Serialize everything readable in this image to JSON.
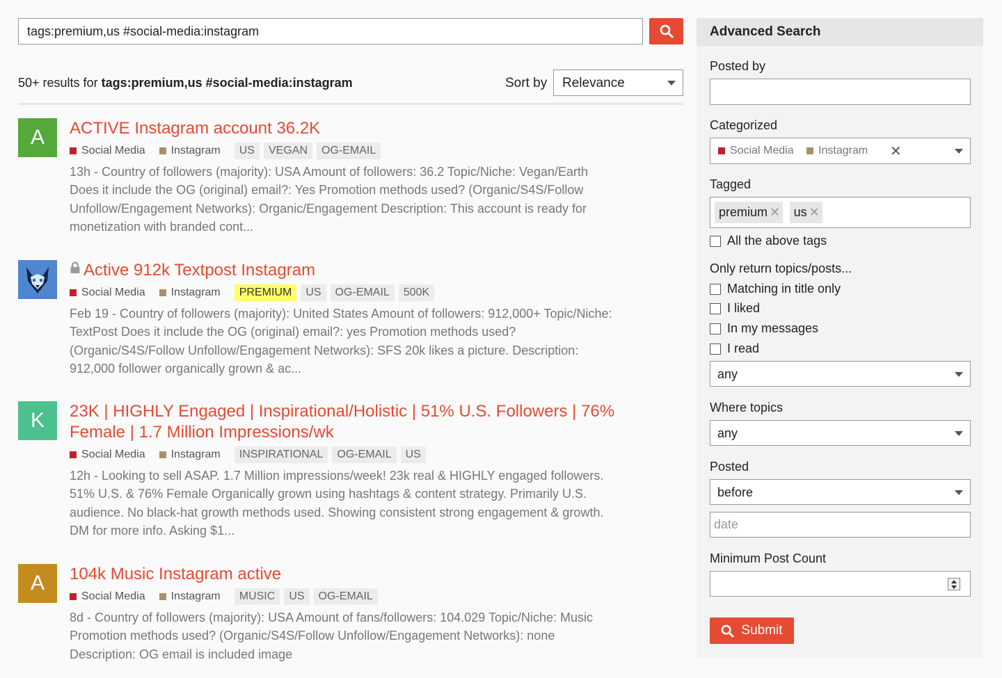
{
  "search": {
    "query": "tags:premium,us #social-media:instagram"
  },
  "results_header": {
    "count_prefix": "50+ results for",
    "query": "tags:premium,us #social-media:instagram",
    "sort_label": "Sort by",
    "sort_value": "Relevance"
  },
  "colors": {
    "accent": "#e64a32",
    "social_media": "#c0202e",
    "instagram": "#a99068",
    "premium_highlight": "#ffff66"
  },
  "results": [
    {
      "avatar_letter": "A",
      "avatar_color": "#55a93a",
      "title": "ACTIVE Instagram account 36.2K",
      "category": "Social Media",
      "subcategory": "Instagram",
      "tags": [
        "US",
        "VEGAN",
        "OG-EMAIL"
      ],
      "excerpt": "13h - Country of followers (majority): USA Amount of followers: 36.2 Topic/Niche: Vegan/Earth Does it include the OG (original) email?: Yes Promotion methods used? (Organic/S4S/Follow Unfollow/Engagement Networks): Organic/Engagement Description: This account is ready for monetization with branded cont..."
    },
    {
      "avatar_letter": "",
      "avatar_icon": "wolf-avatar-icon",
      "title": "Active 912k Textpost Instagram",
      "locked": true,
      "category": "Social Media",
      "subcategory": "Instagram",
      "tags": [
        "PREMIUM",
        "US",
        "OG-EMAIL",
        "500K"
      ],
      "excerpt": "Feb 19 - Country of followers (majority): United States Amount of followers: 912,000+ Topic/Niche: TextPost Does it include the OG (original) email?: yes Promotion methods used? (Organic/S4S/Follow Unfollow/Engagement Networks): SFS 20k likes a picture. Description: 912,000 follower organically grown & ac..."
    },
    {
      "avatar_letter": "K",
      "avatar_color": "#4cc08d",
      "title": "23K | HIGHLY Engaged | Inspirational/Holistic | 51% U.S. Followers | 76% Female | 1.7 Million Impressions/wk",
      "category": "Social Media",
      "subcategory": "Instagram",
      "tags": [
        "INSPIRATIONAL",
        "OG-EMAIL",
        "US"
      ],
      "excerpt": "12h - Looking to sell ASAP. 1.7 Million impressions/week! 23k real & HIGHLY engaged followers. 51% U.S. & 76% Female Organically grown using hashtags & content strategy. Primarily U.S. audience. No black-hat growth methods used. Showing consistent strong engagement & growth. DM for more info. Asking $1..."
    },
    {
      "avatar_letter": "A",
      "avatar_color": "#c48c1e",
      "title": "104k Music Instagram active",
      "category": "Social Media",
      "subcategory": "Instagram",
      "tags": [
        "MUSIC",
        "US",
        "OG-EMAIL"
      ],
      "excerpt": "8d - Country of followers (majority): USA Amount of fans/followers: 104.029 Topic/Niche: Music Promotion methods used? (Organic/S4S/Follow Unfollow/Engagement Networks): none Description: OG email is included image"
    }
  ],
  "advanced": {
    "title": "Advanced Search",
    "posted_by_label": "Posted by",
    "posted_by_value": "",
    "categorized_label": "Categorized",
    "categorized_category": "Social Media",
    "categorized_subcategory": "Instagram",
    "tagged_label": "Tagged",
    "tagged_tags": [
      "premium",
      "us"
    ],
    "all_tags_label": "All the above tags",
    "only_return_label": "Only return topics/posts...",
    "only_return_options": [
      "Matching in title only",
      "I liked",
      "In my messages",
      "I read"
    ],
    "only_return_select": "any",
    "where_topics_label": "Where topics",
    "where_topics_select": "any",
    "posted_label": "Posted",
    "posted_select": "before",
    "date_placeholder": "date",
    "min_post_label": "Minimum Post Count",
    "min_post_value": "",
    "submit_label": "Submit"
  }
}
